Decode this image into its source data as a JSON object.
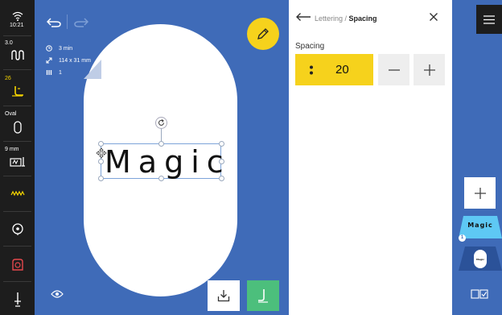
{
  "status_bar": {
    "time": "10:21",
    "tension": "3.0",
    "stitch_length": "26",
    "hoop": "Oval",
    "presser_foot_height": "9 mm"
  },
  "design_info": {
    "time": "3 min",
    "size": "114 x 31 mm",
    "colors": "1"
  },
  "design": {
    "text": "Magic"
  },
  "panel": {
    "breadcrumb_parent": "Lettering",
    "breadcrumb_separator": " / ",
    "breadcrumb_current": "Spacing",
    "section_label": "Spacing",
    "value": "20"
  },
  "layers": [
    {
      "label": "Magic",
      "color": "#5ec8f4",
      "number": "1"
    },
    {
      "label": "Magic",
      "color": "#2b5299"
    }
  ],
  "colors": {
    "workspace": "#3f6bb8",
    "accent_yellow": "#f6d21c",
    "stitch_green": "#4cbf7c",
    "dark": "#1d1d1d"
  }
}
